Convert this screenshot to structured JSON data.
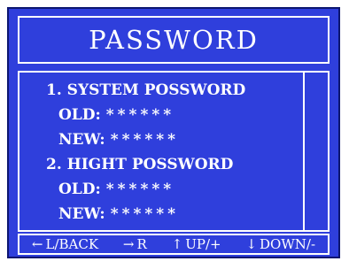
{
  "title": "PASSWORD",
  "sections": [
    {
      "label": "1. SYSTEM POSSWORD",
      "fields": [
        {
          "label": "OLD:",
          "value": "******"
        },
        {
          "label": "NEW:",
          "value": "******"
        }
      ]
    },
    {
      "label": "2. HIGHT POSSWORD",
      "fields": [
        {
          "label": "OLD:",
          "value": "******"
        },
        {
          "label": "NEW:",
          "value": "******"
        }
      ]
    }
  ],
  "footer": [
    {
      "icon": "left-arrow-icon",
      "glyph": "←",
      "label": "L/BACK"
    },
    {
      "icon": "right-arrow-icon",
      "glyph": "→",
      "label": "R"
    },
    {
      "icon": "up-arrow-icon",
      "glyph": "↑",
      "label": "UP/+"
    },
    {
      "icon": "down-arrow-icon",
      "glyph": "↓",
      "label": "DOWN/-"
    }
  ],
  "colors": {
    "background": "#2f3fdc",
    "text": "#ffffff",
    "border": "#ffffff"
  }
}
